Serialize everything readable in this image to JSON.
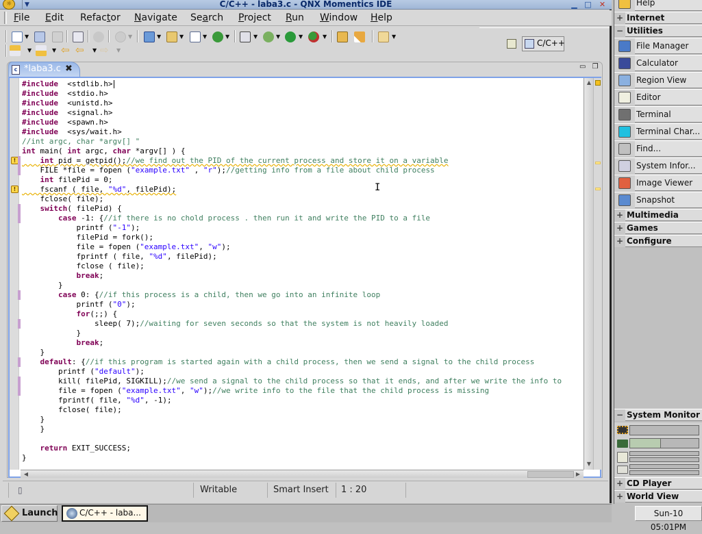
{
  "window": {
    "title": "C/C++ - laba3.c - QNX Momentics IDE",
    "buttons": [
      "minimize",
      "maximize",
      "close"
    ]
  },
  "menu": [
    {
      "label": "File",
      "mnemonic": "F"
    },
    {
      "label": "Edit",
      "mnemonic": "E"
    },
    {
      "label": "Refactor",
      "mnemonic": "t"
    },
    {
      "label": "Navigate",
      "mnemonic": "N"
    },
    {
      "label": "Search",
      "mnemonic": "a"
    },
    {
      "label": "Project",
      "mnemonic": "P"
    },
    {
      "label": "Run",
      "mnemonic": "R"
    },
    {
      "label": "Window",
      "mnemonic": "W"
    },
    {
      "label": "Help",
      "mnemonic": "H"
    }
  ],
  "toolbar": {
    "row1": [
      "new-wizard",
      "save",
      "print",
      "build-binary",
      "debug-target",
      "disabled-tool",
      "new-c-project",
      "new-cpp-project",
      "new-c-file",
      "new-class",
      "open-launch",
      "debug",
      "run",
      "run-external",
      "open-project",
      "search-brush",
      "open-folder"
    ],
    "row2": [
      "next-annotation",
      "prev-annotation",
      "last-edit",
      "back",
      "forward"
    ]
  },
  "perspective": {
    "open_label": "open-perspective",
    "current": "C/C++"
  },
  "editor": {
    "tab": {
      "label": "*laba3.c",
      "dirty": true
    },
    "lines": [
      [
        [
          "kw",
          "#include"
        ],
        [
          "",
          "  "
        ],
        [
          "",
          "<stdlib.h>"
        ]
      ],
      [
        [
          "kw",
          "#include"
        ],
        [
          "",
          "  "
        ],
        [
          "",
          "<stdio.h>"
        ]
      ],
      [
        [
          "kw",
          "#include"
        ],
        [
          "",
          "  "
        ],
        [
          "",
          "<unistd.h>"
        ]
      ],
      [
        [
          "kw",
          "#include"
        ],
        [
          "",
          "  "
        ],
        [
          "",
          "<signal.h>"
        ]
      ],
      [
        [
          "kw",
          "#include"
        ],
        [
          "",
          "  "
        ],
        [
          "",
          "<spawn.h>"
        ]
      ],
      [
        [
          "kw",
          "#include"
        ],
        [
          "",
          "  "
        ],
        [
          "",
          "<sys/wait.h>"
        ]
      ],
      [
        [
          "cm",
          "//int argc, char *argv[] \""
        ]
      ],
      [
        [
          "kw",
          "int"
        ],
        [
          "",
          " main( "
        ],
        [
          "kw",
          "int"
        ],
        [
          "",
          " argc, "
        ],
        [
          "kw",
          "char"
        ],
        [
          "",
          " *argv[] ) {"
        ]
      ],
      [
        [
          "",
          "    "
        ],
        [
          "kw",
          "int"
        ],
        [
          "",
          " pid = getpid();"
        ],
        [
          "cm",
          "//we find out the PID of the current process and store it on a variable"
        ]
      ],
      [
        [
          "",
          "    FILE *file = fopen ("
        ],
        [
          "st",
          "\"example.txt\""
        ],
        [
          "",
          " , "
        ],
        [
          "st",
          "\"r\""
        ],
        [
          "",
          ");"
        ],
        [
          "cm",
          "//getting info from a file about child process"
        ]
      ],
      [
        [
          "",
          "    "
        ],
        [
          "kw",
          "int"
        ],
        [
          "",
          " filePid = 0;"
        ]
      ],
      [
        [
          "",
          "    fscanf ( file, "
        ],
        [
          "st",
          "\"%d\""
        ],
        [
          "",
          ", filePid);"
        ]
      ],
      [
        [
          "",
          "    fclose( file);"
        ]
      ],
      [
        [
          "",
          "    "
        ],
        [
          "kw",
          "switch"
        ],
        [
          "",
          "( filePid) {"
        ]
      ],
      [
        [
          "",
          "        "
        ],
        [
          "kw",
          "case"
        ],
        [
          "",
          " -1: {"
        ],
        [
          "cm",
          "//if there is no chold process . then run it and write the PID to a file"
        ]
      ],
      [
        [
          "",
          "            printf ("
        ],
        [
          "st",
          "\"-1\""
        ],
        [
          "",
          ");"
        ]
      ],
      [
        [
          "",
          "            filePid = fork();"
        ]
      ],
      [
        [
          "",
          "            file = fopen ("
        ],
        [
          "st",
          "\"example.txt\""
        ],
        [
          "",
          ", "
        ],
        [
          "st",
          "\"w\""
        ],
        [
          "",
          ");"
        ]
      ],
      [
        [
          "",
          "            fprintf ( file, "
        ],
        [
          "st",
          "\"%d\""
        ],
        [
          "",
          ", filePid);"
        ]
      ],
      [
        [
          "",
          "            fclose ( file);"
        ]
      ],
      [
        [
          "",
          "            "
        ],
        [
          "kw",
          "break"
        ],
        [
          "",
          ";"
        ]
      ],
      [
        [
          "",
          "        }"
        ]
      ],
      [
        [
          "",
          "        "
        ],
        [
          "kw",
          "case"
        ],
        [
          "",
          " 0: {"
        ],
        [
          "cm",
          "//if this process is a child, then we go into an infinite loop"
        ]
      ],
      [
        [
          "",
          "            printf ("
        ],
        [
          "st",
          "\"0\""
        ],
        [
          "",
          ");"
        ]
      ],
      [
        [
          "",
          "            "
        ],
        [
          "kw",
          "for"
        ],
        [
          "",
          "(;;) {"
        ]
      ],
      [
        [
          "",
          "                sleep( 7);"
        ],
        [
          "cm",
          "//waiting for seven seconds so that the system is not heavily loaded"
        ]
      ],
      [
        [
          "",
          "            }"
        ]
      ],
      [
        [
          "",
          "            "
        ],
        [
          "kw",
          "break"
        ],
        [
          "",
          ";"
        ]
      ],
      [
        [
          "",
          "    }"
        ]
      ],
      [
        [
          "",
          "    "
        ],
        [
          "kw",
          "default"
        ],
        [
          "",
          ": {"
        ],
        [
          "cm",
          "//if this program is started again with a child process, then we send a signal to the child process"
        ]
      ],
      [
        [
          "",
          "        printf ("
        ],
        [
          "st",
          "\"default\""
        ],
        [
          "",
          ");"
        ]
      ],
      [
        [
          "",
          "        kill( filePid, SIGKILL);"
        ],
        [
          "cm",
          "//we send a signal to the child process so that it ends, and after we write the info to"
        ]
      ],
      [
        [
          "",
          "        file = fopen ("
        ],
        [
          "st",
          "\"example.txt\""
        ],
        [
          "",
          ", "
        ],
        [
          "st",
          "\"w\""
        ],
        [
          "",
          ");"
        ],
        [
          "cm",
          "//we write info to the file that the child process is missing"
        ]
      ],
      [
        [
          "",
          "        fprintf( file, "
        ],
        [
          "st",
          "\"%d\""
        ],
        [
          "",
          ", -1);"
        ]
      ],
      [
        [
          "",
          "        fclose( file);"
        ]
      ],
      [
        [
          "",
          "    }"
        ]
      ],
      [
        [
          "",
          "    }"
        ]
      ],
      [
        [
          "",
          ""
        ]
      ],
      [
        [
          "",
          "    "
        ],
        [
          "kw",
          "return"
        ],
        [
          "",
          " EXIT_SUCCESS;"
        ]
      ],
      [
        [
          "",
          "}"
        ]
      ]
    ],
    "warning_lines": [
      8,
      11
    ],
    "change_lines": [
      8,
      9,
      13,
      14,
      22,
      25,
      29,
      31,
      32
    ]
  },
  "statusbar": {
    "mode": "Writable",
    "insert": "Smart Insert",
    "position": "1 : 20"
  },
  "taskbar": {
    "launch": "Launch",
    "task": "C/C++ - laba..."
  },
  "shelf": {
    "top_item": "Help",
    "groups_top": [
      {
        "label": "Internet",
        "expanded": false
      },
      {
        "label": "Utilities",
        "expanded": true
      }
    ],
    "utilities": [
      {
        "label": "File Manager",
        "icon": "file-manager-icon",
        "color": "#4a7ac8"
      },
      {
        "label": "Calculator",
        "icon": "calculator-icon",
        "color": "#3a4a9a"
      },
      {
        "label": "Region View",
        "icon": "region-view-icon",
        "color": "#8ab0e0"
      },
      {
        "label": "Editor",
        "icon": "editor-icon",
        "color": "#f0f0e0"
      },
      {
        "label": "Terminal",
        "icon": "terminal-icon",
        "color": "#707070"
      },
      {
        "label": "Terminal Char...",
        "icon": "terminal-char-icon",
        "color": "#20c0e0"
      },
      {
        "label": "Find...",
        "icon": "find-icon",
        "color": "#c0c0c0"
      },
      {
        "label": "System Infor...",
        "icon": "system-info-icon",
        "color": "#d0d0e0"
      },
      {
        "label": "Image Viewer",
        "icon": "image-viewer-icon",
        "color": "#e06040"
      },
      {
        "label": "Snapshot",
        "icon": "snapshot-icon",
        "color": "#5a8ad0"
      }
    ],
    "groups_mid": [
      {
        "label": "Multimedia",
        "expanded": false
      },
      {
        "label": "Games",
        "expanded": false
      },
      {
        "label": "Configure",
        "expanded": false
      }
    ],
    "system_monitor": {
      "label": "System Monitor",
      "expanded": true,
      "cpu_usage": 0.0,
      "memory_usage": 0.45,
      "disk_usage": [
        0.0,
        0.0
      ],
      "network_usage": [
        0.0,
        0.0
      ]
    },
    "groups_bottom": [
      {
        "label": "CD Player",
        "expanded": false
      },
      {
        "label": "World View",
        "expanded": false
      }
    ],
    "clock": "Sun-10 05:01PM"
  }
}
